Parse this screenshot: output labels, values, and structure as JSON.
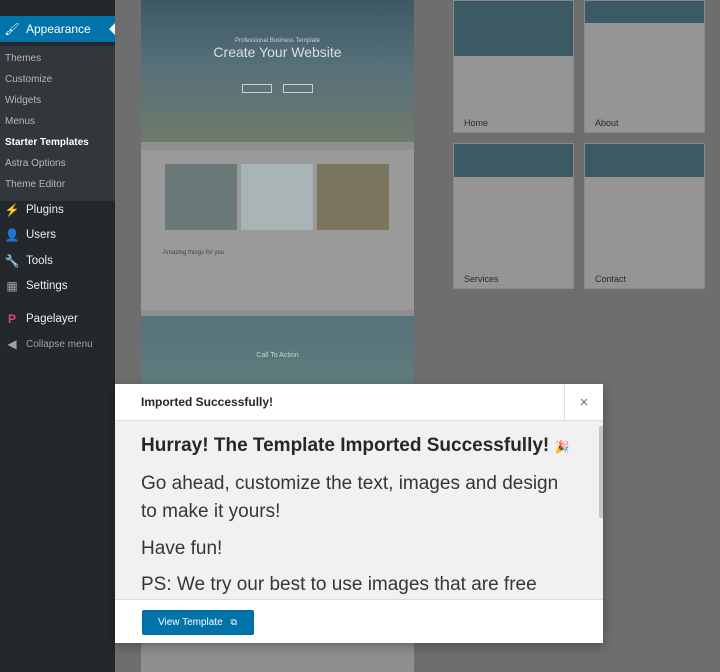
{
  "sidebar": {
    "active": {
      "label": "Appearance",
      "icon": "paintbrush-icon"
    },
    "submenu": [
      "Themes",
      "Customize",
      "Widgets",
      "Menus",
      "Starter Templates",
      "Astra Options",
      "Theme Editor"
    ],
    "current_submenu": "Starter Templates",
    "items": [
      {
        "label": "Plugins",
        "icon": "plug-icon"
      },
      {
        "label": "Users",
        "icon": "user-icon"
      },
      {
        "label": "Tools",
        "icon": "wrench-icon"
      },
      {
        "label": "Settings",
        "icon": "settings-icon"
      },
      {
        "label": "Pagelayer",
        "icon": "pagelayer-icon"
      }
    ],
    "collapse_label": "Collapse menu"
  },
  "preview": {
    "hero_kicker": "Professional Business Template",
    "hero_title": "Create Your Website",
    "cta_title": "Call To Action",
    "section_text": "Amazing things for you"
  },
  "templates": [
    {
      "label": "Home"
    },
    {
      "label": "About"
    },
    {
      "label": "Services"
    },
    {
      "label": "Contact"
    }
  ],
  "modal": {
    "title": "Imported Successfully!",
    "close": "×",
    "heading": "Hurray! The Template Imported Successfully!",
    "heading_emoji": "🎉",
    "para1": "Go ahead, customize the text, images and design to make it yours!",
    "para2": "Have fun!",
    "para3": "PS: We try our best to use images that are free",
    "button_label": "View Template",
    "button_icon": "external-link-icon"
  },
  "colors": {
    "accent": "#0073aa",
    "sidebar": "#23282d"
  }
}
